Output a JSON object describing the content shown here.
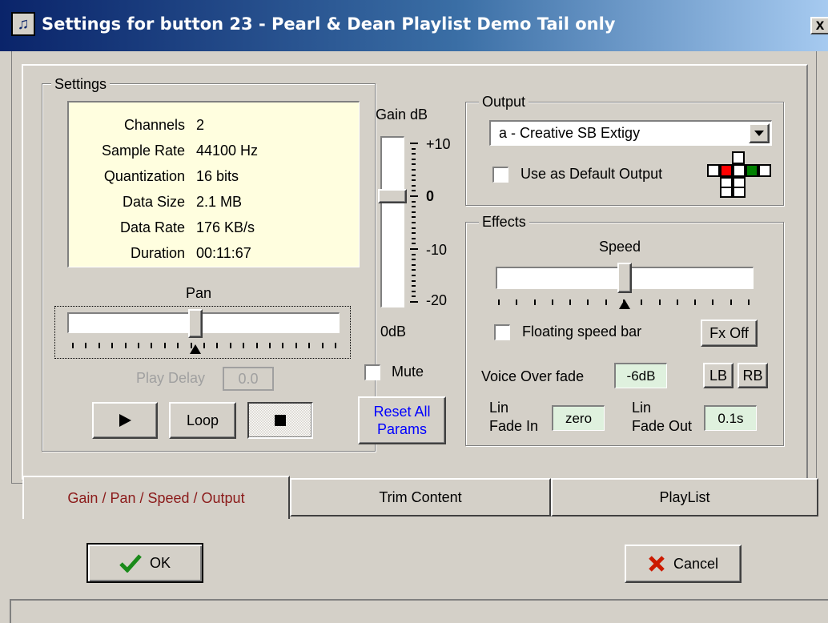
{
  "window": {
    "title": "Settings for button 23 - Pearl & Dean Playlist Demo Tail only",
    "close": "x"
  },
  "settings": {
    "legend": "Settings",
    "info": [
      {
        "label": "Channels",
        "value": "2"
      },
      {
        "label": "Sample Rate",
        "value": "44100 Hz"
      },
      {
        "label": "Quantization",
        "value": "16 bits"
      },
      {
        "label": "Data Size",
        "value": "2.1 MB"
      },
      {
        "label": "Data Rate",
        "value": "176 KB/s"
      },
      {
        "label": "Duration",
        "value": "00:11:67"
      }
    ],
    "pan_label": "Pan",
    "pan_value": 0.5,
    "play_delay_label": "Play Delay",
    "play_delay_value": "0.0",
    "play_icon": "play-icon",
    "loop_label": "Loop",
    "stop_icon": "stop-icon"
  },
  "gain": {
    "label": "Gain dB",
    "scale": [
      "+10",
      "0",
      "-10",
      "-20"
    ],
    "value_label": "0dB",
    "level_db": 0,
    "mute_label": "Mute",
    "reset_label_line1": "Reset All",
    "reset_label_line2": "Params",
    "reset_color": "#0000ff"
  },
  "output": {
    "legend": "Output",
    "device": "a  - Creative SB Extigy",
    "default_label": "Use as Default Output",
    "speaker_icon": "speaker-layout-icon",
    "speaker_colors": {
      "active_left": "#ff0000",
      "active_right": "#008000"
    }
  },
  "effects": {
    "legend": "Effects",
    "speed_label": "Speed",
    "speed_value": 0.5,
    "floating_label": "Floating speed bar",
    "fx_off_label": "Fx Off",
    "voice_over_label": "Voice Over fade",
    "voice_over_value": "-6dB",
    "lb_label": "LB",
    "rb_label": "RB",
    "fade_in_line1": "Lin",
    "fade_in_line2": "Fade In",
    "fade_in_value": "zero",
    "fade_out_line1": "Lin",
    "fade_out_line2": "Fade Out",
    "fade_out_value": "0.1s"
  },
  "tabs": [
    {
      "label": "Gain / Pan / Speed / Output",
      "active": true,
      "color": "#8b1a1a"
    },
    {
      "label": "Trim Content",
      "active": false
    },
    {
      "label": "PlayList",
      "active": false
    }
  ],
  "footer": {
    "ok_label": "OK",
    "ok_icon": "checkmark-icon",
    "cancel_label": "Cancel",
    "cancel_icon": "x-icon"
  }
}
